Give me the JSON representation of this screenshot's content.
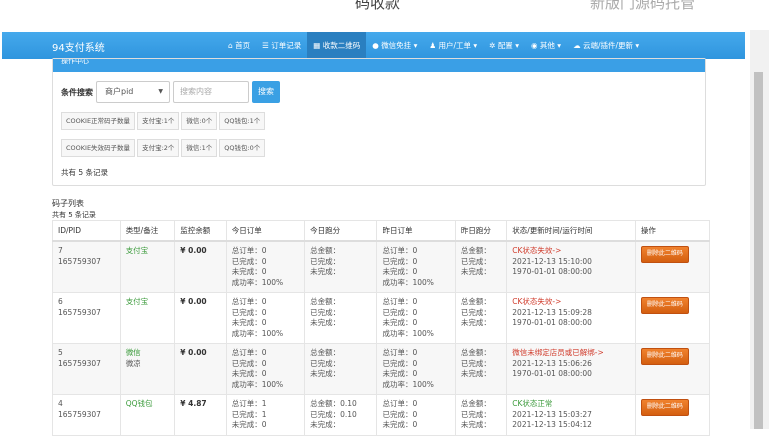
{
  "top": {
    "title": "码收款",
    "right": "新版门源码托管"
  },
  "nav": {
    "brand": "94支付系统",
    "items": [
      {
        "label": "首页",
        "icon": "home-icon"
      },
      {
        "label": "订单记录",
        "icon": "list-icon"
      },
      {
        "label": "收款二维码",
        "icon": "qrcode-icon",
        "active": true
      },
      {
        "label": "微信免挂 ▾",
        "icon": "wechat-icon"
      },
      {
        "label": "用户/工单 ▾",
        "icon": "user-icon"
      },
      {
        "label": "配置 ▾",
        "icon": "gear-icon"
      },
      {
        "label": "其他 ▾",
        "icon": "globe-icon"
      },
      {
        "label": "云端/插件/更新 ▾",
        "icon": "cloud-icon"
      }
    ]
  },
  "panel": {
    "title": "操作中心",
    "search_label": "条件搜索",
    "select_value": "商户pid",
    "input_placeholder": "搜索内容",
    "search_button": "搜索",
    "normal": [
      "COOKIE正常码子数量",
      "支付宝:1个",
      "微信:0个",
      "QQ钱包:1个"
    ],
    "invalid": [
      "COOKIE失效码子数量",
      "支付宝:2个",
      "微信:1个",
      "QQ钱包:0个"
    ],
    "total": "共有 5 条记录"
  },
  "list": {
    "title": "码子列表",
    "count": "共有 5 条记录",
    "headers": [
      "ID/PID",
      "类型/备注",
      "监控余额",
      "今日订单",
      "今日跑分",
      "昨日订单",
      "昨日跑分",
      "状态/更新时间/运行时间",
      "操作"
    ],
    "delete_label": "删除此二维码",
    "rows": [
      {
        "id": "7",
        "pid": "165759307",
        "type": "支付宝",
        "note": "",
        "balance": "¥ 0.00",
        "today": [
          "总订单：0",
          "已完成：0",
          "未完成：0",
          "成功率：100%"
        ],
        "today_amt": [
          "总金额：",
          "已完成：",
          "未完成："
        ],
        "yest": [
          "总订单：0",
          "已完成：0",
          "未完成：0",
          "成功率：100%"
        ],
        "yest_amt": [
          "总金额：",
          "已完成：",
          "未完成："
        ],
        "status": "CK状态失效->",
        "status_ok": false,
        "updated": "2021-12-13 15:10:00",
        "run": "1970-01-01 08:00:00"
      },
      {
        "id": "6",
        "pid": "165759307",
        "type": "支付宝",
        "note": "",
        "balance": "¥ 0.00",
        "today": [
          "总订单：0",
          "已完成：0",
          "未完成：0",
          "成功率：100%"
        ],
        "today_amt": [
          "总金额：",
          "已完成：",
          "未完成："
        ],
        "yest": [
          "总订单：0",
          "已完成：0",
          "未完成：0",
          "成功率：100%"
        ],
        "yest_amt": [
          "总金额：",
          "已完成：",
          "未完成："
        ],
        "status": "CK状态失效->",
        "status_ok": false,
        "updated": "2021-12-13 15:09:28",
        "run": "1970-01-01 08:00:00"
      },
      {
        "id": "5",
        "pid": "165759307",
        "type": "微信",
        "note": "微凉",
        "balance": "¥ 0.00",
        "today": [
          "总订单：0",
          "已完成：0",
          "未完成：0",
          "成功率：100%"
        ],
        "today_amt": [
          "总金额：",
          "已完成：",
          "未完成："
        ],
        "yest": [
          "总订单：0",
          "已完成：0",
          "未完成：0",
          "成功率：100%"
        ],
        "yest_amt": [
          "总金额：",
          "已完成：",
          "未完成："
        ],
        "status": "微信未绑定店员或已解绑->",
        "status_ok": false,
        "updated": "2021-12-13 15:06:26",
        "run": "1970-01-01 08:00:00"
      },
      {
        "id": "4",
        "pid": "165759307",
        "type": "QQ钱包",
        "note": "",
        "balance": "¥ 4.87",
        "today": [
          "总订单：1",
          "已完成：1",
          "未完成：0"
        ],
        "today_amt": [
          "总金额：0.10",
          "已完成：0.10",
          "未完成："
        ],
        "yest": [
          "总订单：0",
          "已完成：0",
          "未完成：0"
        ],
        "yest_amt": [
          "总金额：",
          "已完成：",
          "未完成："
        ],
        "status": "CK状态正常",
        "status_ok": true,
        "updated": "2021-12-13 15:03:27",
        "run": "2021-12-13 15:04:12"
      }
    ]
  }
}
